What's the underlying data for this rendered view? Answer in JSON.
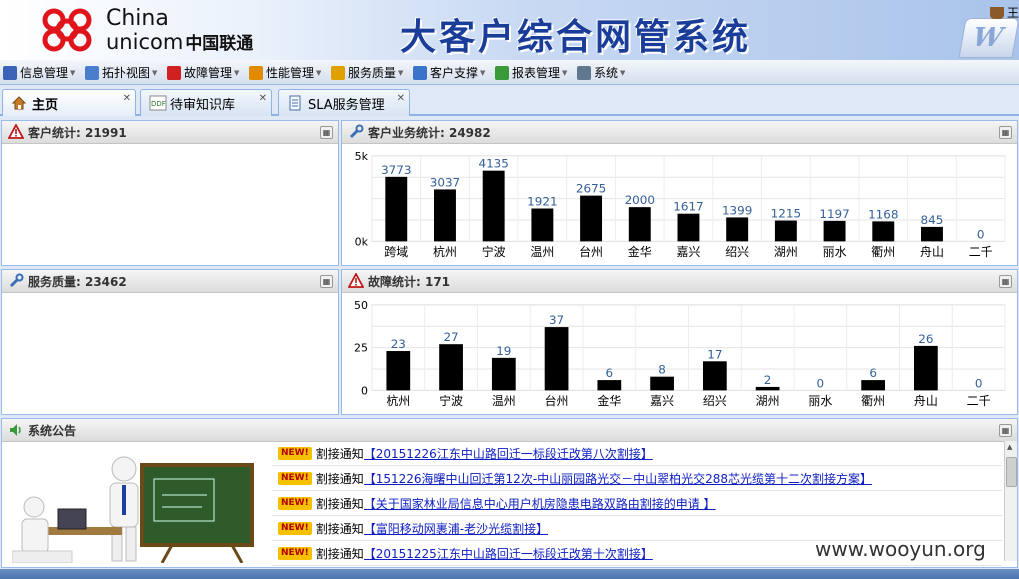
{
  "logo": {
    "china": "China",
    "unicom": "unicom",
    "unicom_cn": "中国联通"
  },
  "header": {
    "title": "大客户综合网管系统",
    "badge": "W"
  },
  "menu": [
    {
      "label": "信息管理",
      "icon": "info-icon",
      "color": "#3a63b8"
    },
    {
      "label": "拓扑视图",
      "icon": "topology-icon",
      "color": "#4a7dcc"
    },
    {
      "label": "故障管理",
      "icon": "warning-icon",
      "color": "#d02020"
    },
    {
      "label": "性能管理",
      "icon": "performance-icon",
      "color": "#e08a00"
    },
    {
      "label": "服务质量",
      "icon": "service-icon",
      "color": "#e0a000"
    },
    {
      "label": "客户支撑",
      "icon": "customer-icon",
      "color": "#3a73c8"
    },
    {
      "label": "报表管理",
      "icon": "report-icon",
      "color": "#3a9a3a"
    },
    {
      "label": "系统",
      "icon": "system-icon",
      "color": "#607890"
    }
  ],
  "menu_right": "王",
  "tabs": [
    {
      "label": "主页",
      "icon": "home-icon",
      "active": true
    },
    {
      "label": "待审知识库",
      "icon": "ddf-icon",
      "active": false
    },
    {
      "label": "SLA服务管理",
      "icon": "document-icon",
      "active": false
    }
  ],
  "panels": {
    "customer": {
      "title": "客户统计: 21991"
    },
    "business": {
      "title": "客户业务统计: 24982"
    },
    "quality": {
      "title": "服务质量: 23462"
    },
    "fault": {
      "title": "故障统计: 171"
    },
    "notice": {
      "title": "系统公告"
    }
  },
  "chart_data": [
    {
      "type": "bar",
      "categories": [
        "跨域",
        "杭州",
        "宁波",
        "温州",
        "台州",
        "金华",
        "嘉兴",
        "绍兴",
        "湖州",
        "丽水",
        "衢州",
        "舟山",
        "二千"
      ],
      "values": [
        3773,
        3037,
        4135,
        1921,
        2675,
        2000,
        1617,
        1399,
        1215,
        1197,
        1168,
        845,
        0
      ],
      "data_labels": [
        "3773",
        "3037",
        "4135",
        "1921",
        "2675",
        "2000",
        "1617",
        "1399",
        "1215",
        "1197",
        "1168",
        "845",
        "0"
      ],
      "ytick_labels": [
        "5k",
        "0k"
      ],
      "ylim": [
        0,
        5000
      ],
      "grid": true
    },
    {
      "type": "bar",
      "categories": [
        "杭州",
        "宁波",
        "温州",
        "台州",
        "金华",
        "嘉兴",
        "绍兴",
        "湖州",
        "丽水",
        "衢州",
        "舟山",
        "二千"
      ],
      "values": [
        23,
        27,
        19,
        37,
        6,
        8,
        17,
        2,
        0,
        6,
        26,
        0
      ],
      "data_labels": [
        "23",
        "27",
        "19",
        "37",
        "6",
        "8",
        "17",
        "2",
        "0",
        "6",
        "26",
        "0"
      ],
      "ytick_labels": [
        "50",
        "25",
        "0"
      ],
      "ylim": [
        0,
        50
      ],
      "grid": true
    }
  ],
  "notices": [
    {
      "badge": "NEW!",
      "type": "割接通知",
      "text": "【20151226江东中山路回迁一标段迁改第八次割接】"
    },
    {
      "badge": "NEW!",
      "type": "割接通知",
      "text": "【151226海曙中山回迁第12次-中山丽园路光交－中山翠柏光交288芯光缆第十二次割接方案】"
    },
    {
      "badge": "NEW!",
      "type": "割接通知",
      "text": "【关于国家林业局信息中心用户机房隐患电路双路由割接的申请 】"
    },
    {
      "badge": "NEW!",
      "type": "割接通知",
      "text": "【富阳移动网裹浦-老沙光缆割接】"
    },
    {
      "badge": "NEW!",
      "type": "割接通知",
      "text": "【20151225江东中山路回迁一标段迁改第十次割接】"
    }
  ],
  "watermark": "www.wooyun.org"
}
